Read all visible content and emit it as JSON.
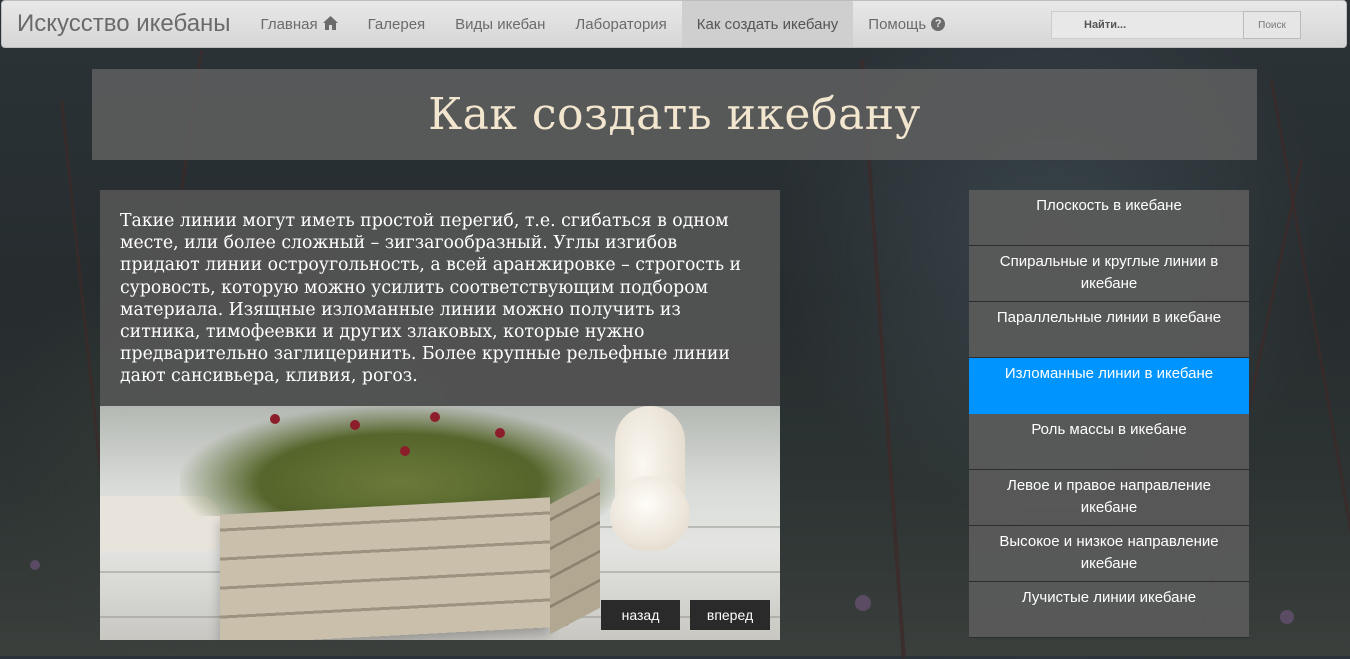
{
  "navbar": {
    "brand": "Искусство икебаны",
    "items": [
      {
        "label": "Главная",
        "icon": "home-icon"
      },
      {
        "label": "Галерея"
      },
      {
        "label": "Виды икебан"
      },
      {
        "label": "Лаборатория"
      },
      {
        "label": "Как создать икебану",
        "active": true
      },
      {
        "label": "Помощь",
        "icon": "question-circle-icon"
      }
    ],
    "search_placeholder": "Найти...",
    "search_button": "Поиск"
  },
  "page": {
    "title": "Как создать икебану",
    "body_text": "Такие линии могут иметь простой перегиб, т.е. сгибаться в одном месте, или более сложный – зигзагообразный. Углы изгибов придают линии остроугольность, а всей аранжировке – строгость и суровость, которую можно усилить соответствующим подбором материала. Изящные изломанные линии можно получить из ситника, тимофеевки и других злаковых, которые нужно предварительно заглицеринить. Более крупные рельефные линии дают сансивьера, кливия, рогоз."
  },
  "slider": {
    "back_label": "назад",
    "forward_label": "вперед"
  },
  "side_menu": {
    "items": [
      {
        "label": "Плоскость в икебане"
      },
      {
        "label": "Спиральные и круглые линии в икебане"
      },
      {
        "label": "Параллельные линии в икебане"
      },
      {
        "label": "Изломанные линии в икебане",
        "active": true
      },
      {
        "label": "Роль массы в икебане"
      },
      {
        "label": "Левое и правое направление икебане"
      },
      {
        "label": "Высокое и низкое направление икебане"
      },
      {
        "label": "Лучистые линии икебане"
      }
    ]
  },
  "colors": {
    "active_menu": "#0094ff",
    "title_text": "#f3e6cf",
    "panel_bg": "#555555"
  }
}
